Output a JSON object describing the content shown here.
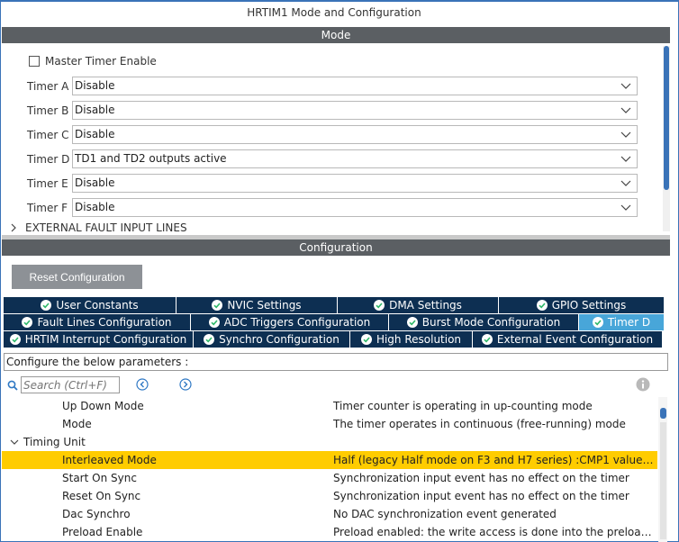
{
  "window": {
    "title": "HRTIM1 Mode and Configuration"
  },
  "mode_section": {
    "header": "Mode",
    "master_enable_label": "Master Timer Enable",
    "master_enable_checked": false,
    "timers": [
      {
        "label": "Timer A",
        "value": "Disable"
      },
      {
        "label": "Timer B",
        "value": "Disable"
      },
      {
        "label": "Timer C",
        "value": "Disable"
      },
      {
        "label": "Timer D",
        "value": "TD1 and TD2 outputs active"
      },
      {
        "label": "Timer E",
        "value": "Disable"
      },
      {
        "label": "Timer F",
        "value": "Disable"
      }
    ],
    "external_fault_label": "EXTERNAL FAULT INPUT LINES"
  },
  "config_section": {
    "header": "Configuration",
    "reset_button": "Reset Configuration",
    "tabs": [
      [
        "User Constants",
        "NVIC Settings",
        "DMA Settings",
        "GPIO Settings"
      ],
      [
        "Fault Lines Configuration",
        "ADC Triggers Configuration",
        "Burst Mode Configuration",
        "Timer D"
      ],
      [
        "HRTIM Interrupt Configuration",
        "Synchro Configuration",
        "High Resolution",
        "External Event Configuration"
      ]
    ],
    "active_tab": "Timer D",
    "params_label": "Configure the below parameters :",
    "search_placeholder": "Search (Ctrl+F)",
    "rows": [
      {
        "name": "Up Down Mode",
        "value": "Timer counter is operating in up-counting mode"
      },
      {
        "name": "Mode",
        "value": "The timer operates in continuous (free-running) mode"
      },
      {
        "group": "Timing Unit"
      },
      {
        "name": "Interleaved Mode",
        "value": "Half (legacy Half mode on F3 and H7 series) :CMP1 value s..."
      },
      {
        "name": "Start On Sync",
        "value": "Synchronization input event has no effect on the timer"
      },
      {
        "name": "Reset On Sync",
        "value": "Synchronization input event has no effect on the timer"
      },
      {
        "name": "Dac Synchro",
        "value": "No DAC synchronization event generated"
      },
      {
        "name": "Preload Enable",
        "value": "Preload enabled: the write access is done into the preload r..."
      }
    ],
    "selected_row": "Interleaved Mode"
  },
  "colors": {
    "section_header": "#5b5f63",
    "tab_bg": "#0d2f52",
    "tab_active": "#48a6d9",
    "tab_check": "#2fb86a",
    "selected_row": "#ffcc00",
    "scroll_thumb": "#3a73b8"
  },
  "icons": {
    "checkmark": "check-circle-icon",
    "dropdown": "chevron-down-icon",
    "search": "search-icon",
    "prev": "arrow-left-circle-icon",
    "next": "arrow-right-circle-icon",
    "info": "info-icon",
    "collapse": "chevron-down-icon",
    "expand": "chevron-right-icon"
  }
}
